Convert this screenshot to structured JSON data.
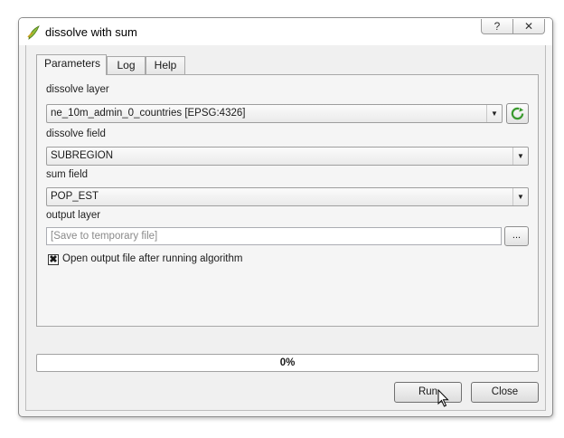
{
  "window": {
    "title": "dissolve with sum",
    "help_glyph": "?",
    "close_glyph": "✕"
  },
  "tabs": [
    {
      "label": "Parameters",
      "active": true
    },
    {
      "label": "Log",
      "active": false
    },
    {
      "label": "Help",
      "active": false
    }
  ],
  "params": {
    "dissolve_layer": {
      "label": "dissolve layer",
      "value": "ne_10m_admin_0_countries [EPSG:4326]"
    },
    "dissolve_field": {
      "label": "dissolve field",
      "value": "SUBREGION"
    },
    "sum_field": {
      "label": "sum field",
      "value": "POP_EST"
    },
    "output_layer": {
      "label": "output layer",
      "value": "",
      "placeholder": "[Save to temporary file]",
      "browse_label": "..."
    },
    "open_output": {
      "label": "Open output file after running algorithm",
      "checked": true,
      "mark": "✖"
    }
  },
  "progress": {
    "text": "0%",
    "value": 0
  },
  "buttons": {
    "run": "Run",
    "close": "Close"
  },
  "colors": {
    "progress_fill": "#3b9c3b",
    "refresh_icon": "#3a9a2e"
  }
}
